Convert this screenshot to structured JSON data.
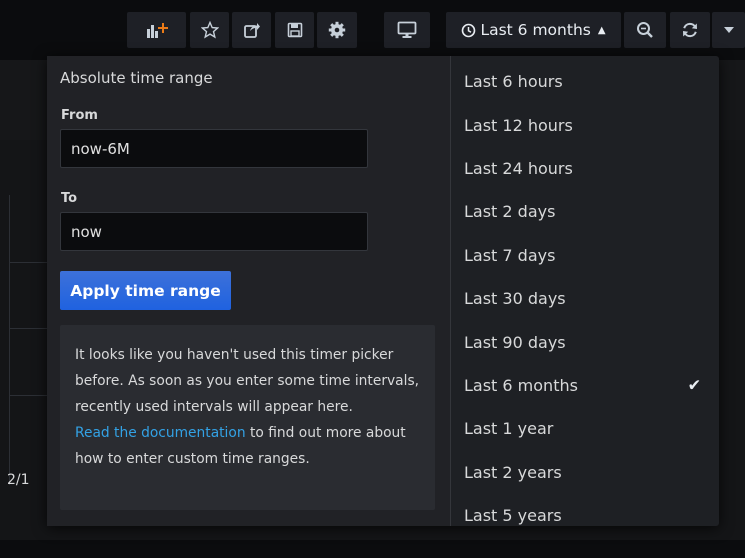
{
  "navbar": {
    "add_panel_icon": "bar-chart-plus-icon",
    "star_icon": "star-icon",
    "share_icon": "share-icon",
    "save_icon": "save-icon",
    "settings_icon": "gear-icon",
    "tv_icon": "monitor-icon",
    "time_picker_label": "Last 6 months",
    "zoom_icon": "zoom-out-icon",
    "refresh_icon": "refresh-icon"
  },
  "background": {
    "axis_label": "2/1"
  },
  "picker": {
    "absolute_title": "Absolute time range",
    "from_label": "From",
    "from_value": "now-6M",
    "to_label": "To",
    "to_value": "now",
    "apply_label": "Apply time range",
    "info_text": "It looks like you haven't used this timer picker before. As soon as you enter some time intervals, recently used intervals will appear here.",
    "info_link": "Read the documentation",
    "info_suffix": " to find out more about how to enter custom time ranges."
  },
  "quick_ranges": [
    {
      "label": "Last 6 hours",
      "selected": false
    },
    {
      "label": "Last 12 hours",
      "selected": false
    },
    {
      "label": "Last 24 hours",
      "selected": false
    },
    {
      "label": "Last 2 days",
      "selected": false
    },
    {
      "label": "Last 7 days",
      "selected": false
    },
    {
      "label": "Last 30 days",
      "selected": false
    },
    {
      "label": "Last 90 days",
      "selected": false
    },
    {
      "label": "Last 6 months",
      "selected": true
    },
    {
      "label": "Last 1 year",
      "selected": false
    },
    {
      "label": "Last 2 years",
      "selected": false
    },
    {
      "label": "Last 5 years",
      "selected": false
    }
  ],
  "colors": {
    "accent": "#1f62e0",
    "link": "#33a2e5",
    "panel_bg": "#1e2024"
  }
}
